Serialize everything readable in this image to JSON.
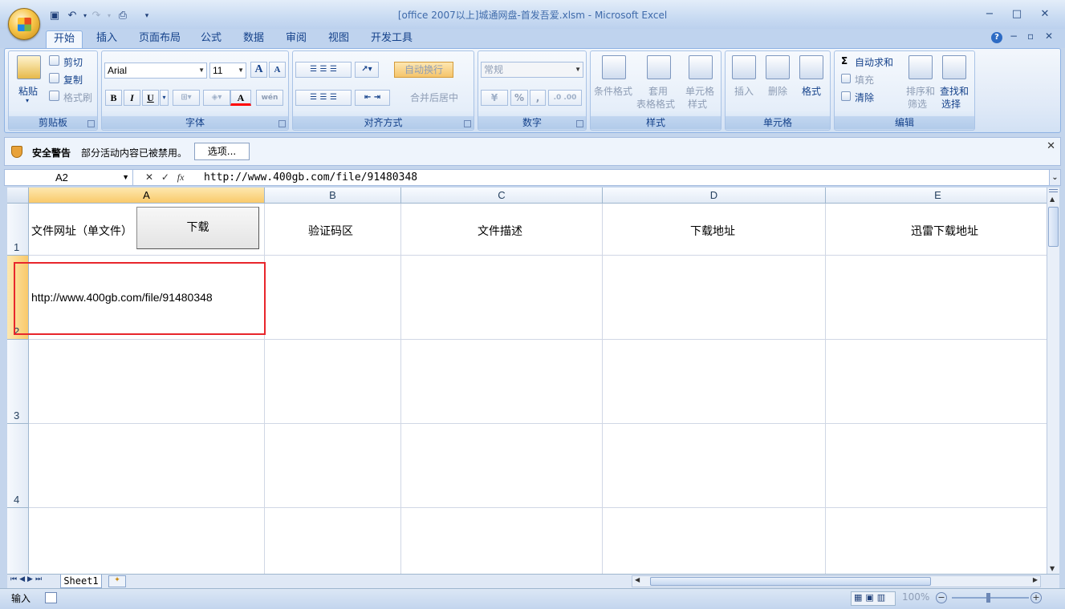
{
  "window": {
    "title": "[office 2007以上]城通网盘-首发吾爱.xlsm - Microsoft Excel",
    "minimize": "−",
    "maximize": "□",
    "close": "✕"
  },
  "tabs": [
    "开始",
    "插入",
    "页面布局",
    "公式",
    "数据",
    "审阅",
    "视图",
    "开发工具"
  ],
  "ribbon": {
    "clipboard": {
      "label": "剪贴板",
      "paste": "粘贴",
      "cut": "剪切",
      "copy": "复制",
      "format_painter": "格式刷"
    },
    "font": {
      "label": "字体",
      "name": "Arial",
      "size": "11",
      "bold": "B",
      "italic": "I",
      "underline": "U",
      "grow": "A",
      "shrink": "A",
      "font_color": "A",
      "wen": "wén"
    },
    "alignment": {
      "label": "对齐方式",
      "wrap": "自动换行",
      "merge": "合并后居中"
    },
    "number": {
      "label": "数字",
      "format": "常规",
      "percent": "%",
      "comma": ","
    },
    "styles": {
      "label": "样式",
      "conditional": "条件格式",
      "table_1": "套用",
      "table_2": "表格格式",
      "cell_1": "单元格",
      "cell_2": "样式"
    },
    "cells": {
      "label": "单元格",
      "insert": "插入",
      "delete": "删除",
      "format": "格式"
    },
    "editing": {
      "label": "编辑",
      "autosum": "自动求和",
      "fill": "填充",
      "clear": "清除",
      "sort_1": "排序和",
      "sort_2": "筛选",
      "find_1": "查找和",
      "find_2": "选择",
      "sigma": "Σ"
    }
  },
  "security": {
    "title": "安全警告",
    "message": "部分活动内容已被禁用。",
    "options_button": "选项..."
  },
  "formula_bar": {
    "name_box": "A2",
    "fx": "fx",
    "content": "http://www.400gb.com/file/91480348"
  },
  "columns": [
    "A",
    "B",
    "C",
    "D",
    "E"
  ],
  "rows": [
    "1",
    "2",
    "3",
    "4"
  ],
  "cells": {
    "A1": "文件网址（单文件）",
    "B1": "验证码区",
    "C1": "文件描述",
    "D1": "下载地址",
    "E1": "迅雷下载地址",
    "A2": "http://www.400gb.com/file/91480348"
  },
  "download_button": "下载",
  "sheet": {
    "tab": "Sheet1"
  },
  "status": {
    "mode": "输入",
    "zoom": "100%"
  }
}
